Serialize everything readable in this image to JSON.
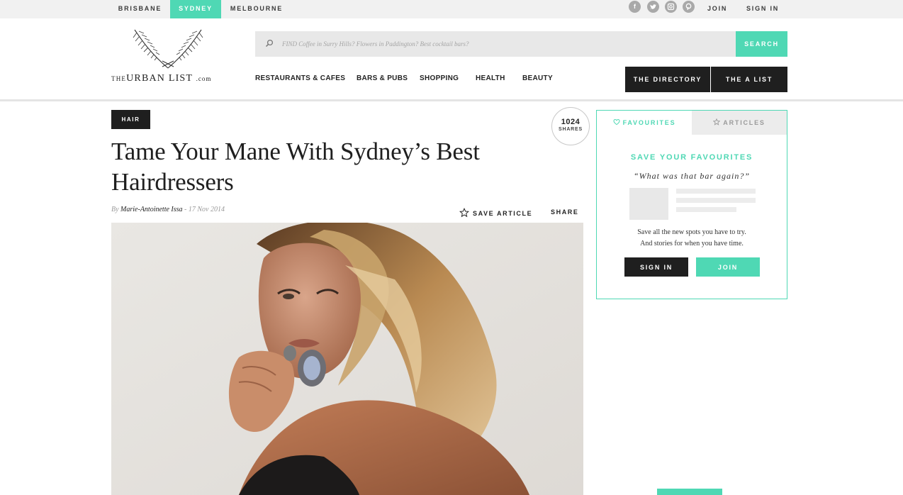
{
  "top_bar": {
    "cities": [
      "BRISBANE",
      "SYDNEY",
      "MELBOURNE"
    ],
    "active_city": "SYDNEY",
    "social_icons": [
      "facebook-icon",
      "twitter-icon",
      "instagram-icon",
      "pinterest-icon"
    ],
    "join_label": "JOIN",
    "signin_label": "SIGN IN"
  },
  "header": {
    "logo": {
      "the": "THE",
      "name": "URBAN LIST",
      "com": ".com"
    },
    "search": {
      "placeholder": "FIND Coffee in Surry Hills? Flowers in Paddington? Best cocktail bars?",
      "button_label": "SEARCH"
    },
    "nav": [
      "RESTAURANTS & CAFES",
      "BARS & PUBS",
      "SHOPPING",
      "HEALTH",
      "BEAUTY"
    ],
    "directory_label": "THE DIRECTORY",
    "alist_label": "THE A LIST"
  },
  "article": {
    "tag": "HAIR",
    "shares_count": "1024",
    "shares_label": "SHARES",
    "title": "Tame Your Mane With Sydney’s Best Hairdressers",
    "byline_prefix": "By",
    "author": "Marie-Antoinette Issa",
    "date_separator": "-",
    "date": "17 Nov 2014",
    "save_label": "SAVE ARTICLE",
    "share_label": "SHARE"
  },
  "sidebar": {
    "tab_favourites": "FAVOURITES",
    "tab_articles": "ARTICLES",
    "heading": "SAVE YOUR FAVOURITES",
    "quote": "“What was that bar again?”",
    "desc_line1": "Save all the new spots you have to try.",
    "desc_line2": "And stories for when you have time.",
    "signin_label": "SIGN IN",
    "join_label": "JOIN"
  },
  "colors": {
    "accent": "#4fd8b4",
    "dark": "#1f1f1f",
    "topbar_bg": "#f1f1f1"
  }
}
